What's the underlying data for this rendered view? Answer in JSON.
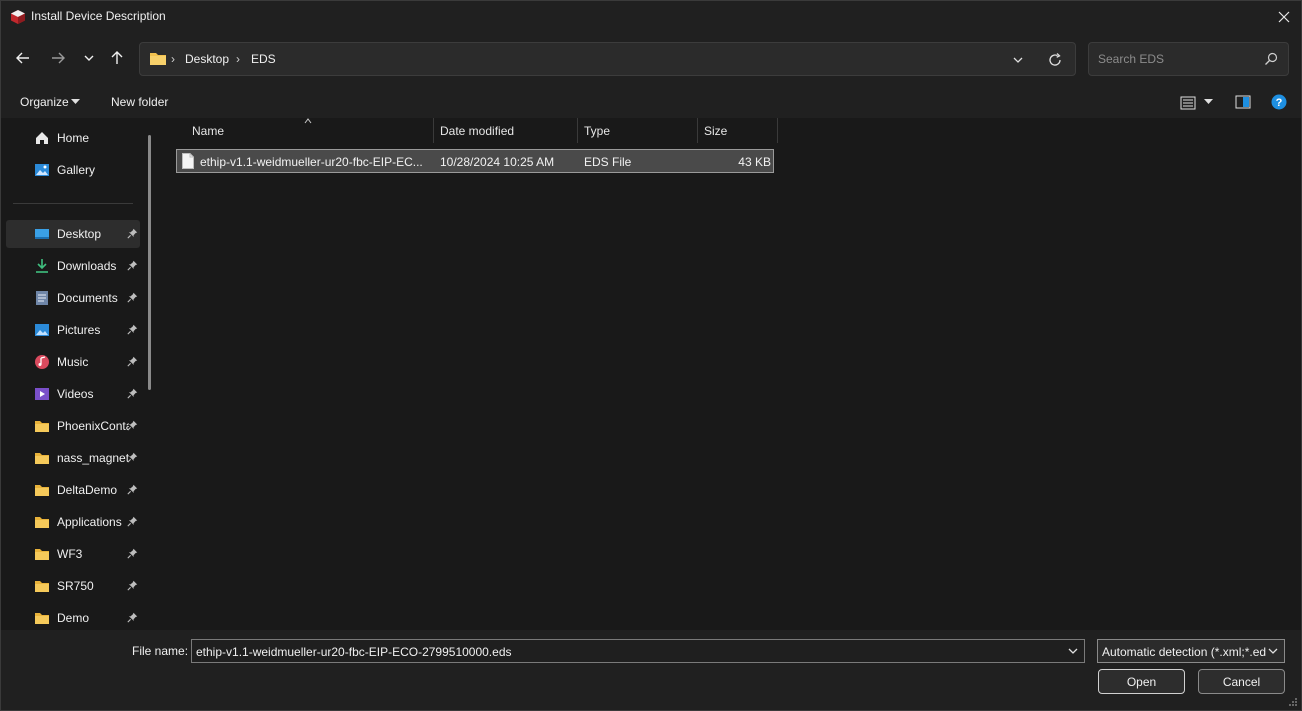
{
  "window": {
    "title": "Install Device Description"
  },
  "address": {
    "crumbs": [
      "Desktop",
      "EDS"
    ]
  },
  "search": {
    "placeholder": "Search EDS"
  },
  "commands": {
    "organize": "Organize",
    "new_folder": "New folder"
  },
  "sidebar": {
    "items": [
      {
        "label": "Home",
        "icon": "home-icon",
        "pinned": false
      },
      {
        "label": "Gallery",
        "icon": "gallery-icon",
        "pinned": false
      },
      {
        "label": "Desktop",
        "icon": "desktop-icon",
        "pinned": true
      },
      {
        "label": "Downloads",
        "icon": "downloads-icon",
        "pinned": true
      },
      {
        "label": "Documents",
        "icon": "documents-icon",
        "pinned": true
      },
      {
        "label": "Pictures",
        "icon": "pictures-icon",
        "pinned": true
      },
      {
        "label": "Music",
        "icon": "music-icon",
        "pinned": true
      },
      {
        "label": "Videos",
        "icon": "videos-icon",
        "pinned": true
      },
      {
        "label": "PhoenixContact",
        "icon": "folder-icon",
        "pinned": true
      },
      {
        "label": "nass_magnet",
        "icon": "folder-icon",
        "pinned": true
      },
      {
        "label": "DeltaDemo",
        "icon": "folder-icon",
        "pinned": true
      },
      {
        "label": "Applications",
        "icon": "folder-icon",
        "pinned": true
      },
      {
        "label": "WF3",
        "icon": "folder-icon",
        "pinned": true
      },
      {
        "label": "SR750",
        "icon": "folder-icon",
        "pinned": true
      },
      {
        "label": "Demo",
        "icon": "folder-icon",
        "pinned": true
      }
    ]
  },
  "columns": {
    "name": "Name",
    "date": "Date modified",
    "type": "Type",
    "size": "Size"
  },
  "files": [
    {
      "name": "ethip-v1.1-weidmueller-ur20-fbc-EIP-EC...",
      "date": "10/28/2024 10:25 AM",
      "type": "EDS File",
      "size": "43 KB"
    }
  ],
  "bottom": {
    "file_name_label": "File name:",
    "file_name_value": "ethip-v1.1-weidmueller-ur20-fbc-EIP-ECO-2799510000.eds",
    "file_type_value": "Automatic detection (*.xml;*.eds)",
    "open_label": "Open",
    "cancel_label": "Cancel"
  },
  "colors": {
    "folder": "#f2c14e",
    "accent": "#1e8fe1",
    "brand": "#c0282d"
  }
}
